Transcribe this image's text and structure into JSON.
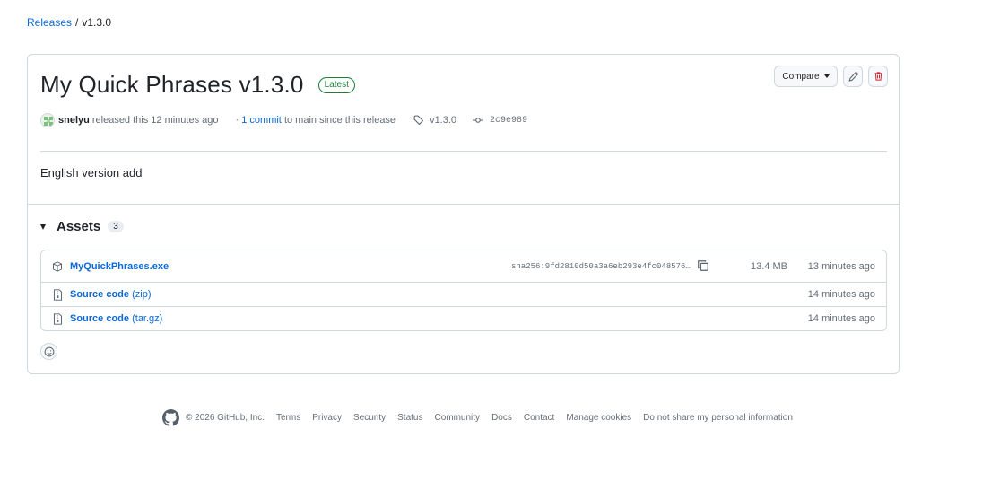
{
  "breadcrumb": {
    "releases": "Releases",
    "separator": "/",
    "current": "v1.3.0"
  },
  "release": {
    "title": "My Quick Phrases v1.3.0",
    "badge": "Latest",
    "author": "snelyu",
    "released_text": "released this 12 minutes ago",
    "commit_prefix": "·",
    "commit_link": "1 commit",
    "commit_suffix": "to main since this release",
    "tag": "v1.3.0",
    "commit_hash": "2c9e989",
    "body": "English version add"
  },
  "actions": {
    "compare_label": "Compare",
    "edit_icon": "pencil-icon",
    "delete_icon": "trash-icon"
  },
  "assets": {
    "title": "Assets",
    "count": "3",
    "items": [
      {
        "name": "MyQuickPhrases.exe",
        "sha": "sha256:9fd2810d50a3a6eb293e4fc048576…",
        "size": "13.4 MB",
        "time": "13 minutes ago",
        "icon": "package-icon"
      },
      {
        "name": "Source code",
        "format": "(zip)",
        "time": "14 minutes ago",
        "icon": "file-zip-icon"
      },
      {
        "name": "Source code",
        "format": "(tar.gz)",
        "time": "14 minutes ago",
        "icon": "file-zip-icon"
      }
    ]
  },
  "footer": {
    "copyright": "© 2026 GitHub, Inc.",
    "links": [
      "Terms",
      "Privacy",
      "Security",
      "Status",
      "Community",
      "Docs",
      "Contact",
      "Manage cookies",
      "Do not share my personal information"
    ]
  },
  "colors": {
    "link": "#0969da",
    "latest_badge": "#1a7f37",
    "danger": "#cf222e",
    "border": "#d0d7de"
  }
}
